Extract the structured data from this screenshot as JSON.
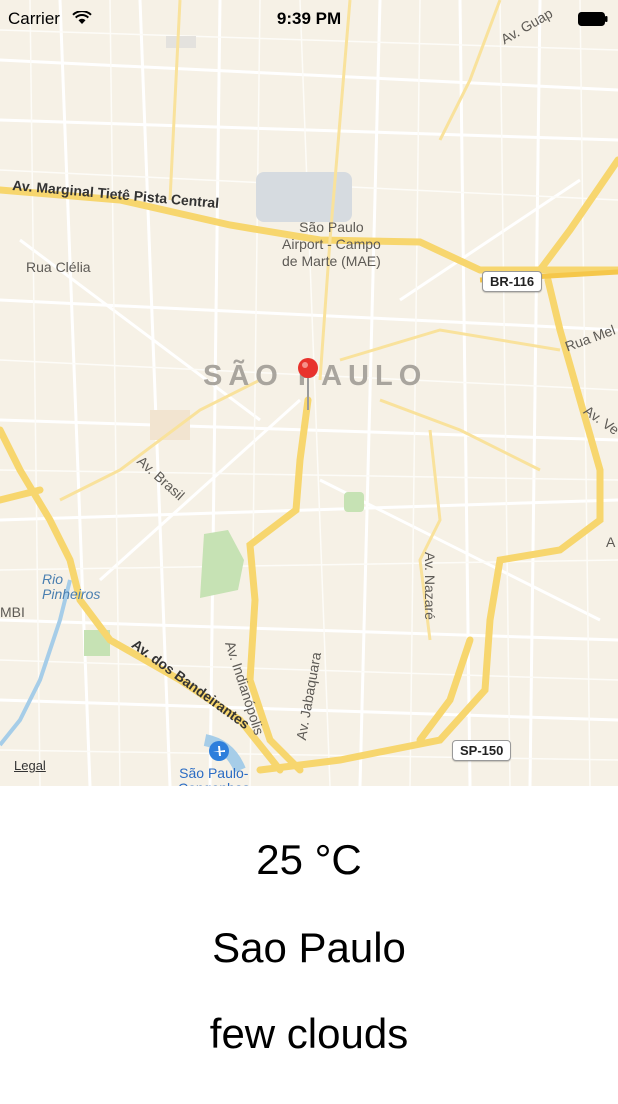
{
  "status_bar": {
    "carrier": "Carrier",
    "time": "9:39 PM",
    "wifi_icon": "wifi-icon",
    "battery_icon": "battery-icon"
  },
  "map": {
    "city_label": "SÃO PAULO",
    "labels": {
      "marginal": "Av. Marginal Tietê Pista Central",
      "airport_mae": "São Paulo\nAirport - Campo\nde Marte (MAE)",
      "rua_clelia": "Rua Clélia",
      "br116": "BR-116",
      "rua_mel": "Rua Mel",
      "av_ve": "Av. Ve",
      "av_guap": "Av. Guap",
      "av_brasil": "Av. Brasil",
      "rio_pinheiros": "Rio\nPinheiros",
      "mbi": "MBI",
      "av_bandeirantes": "Av. dos Bandeirantes",
      "av_indianopolis": "Av. Indianópolis",
      "av_jabaquara": "Av. Jabaquara",
      "av_nazare": "Av. Nazaré",
      "sp150": "SP-150",
      "airport_cgh": "São Paulo-\nCongonhas",
      "edge_a": "A",
      "legal": "Legal"
    },
    "pin_color": "#e8322c"
  },
  "weather": {
    "temperature": "25 °C",
    "city": "Sao Paulo",
    "description": "few clouds"
  }
}
